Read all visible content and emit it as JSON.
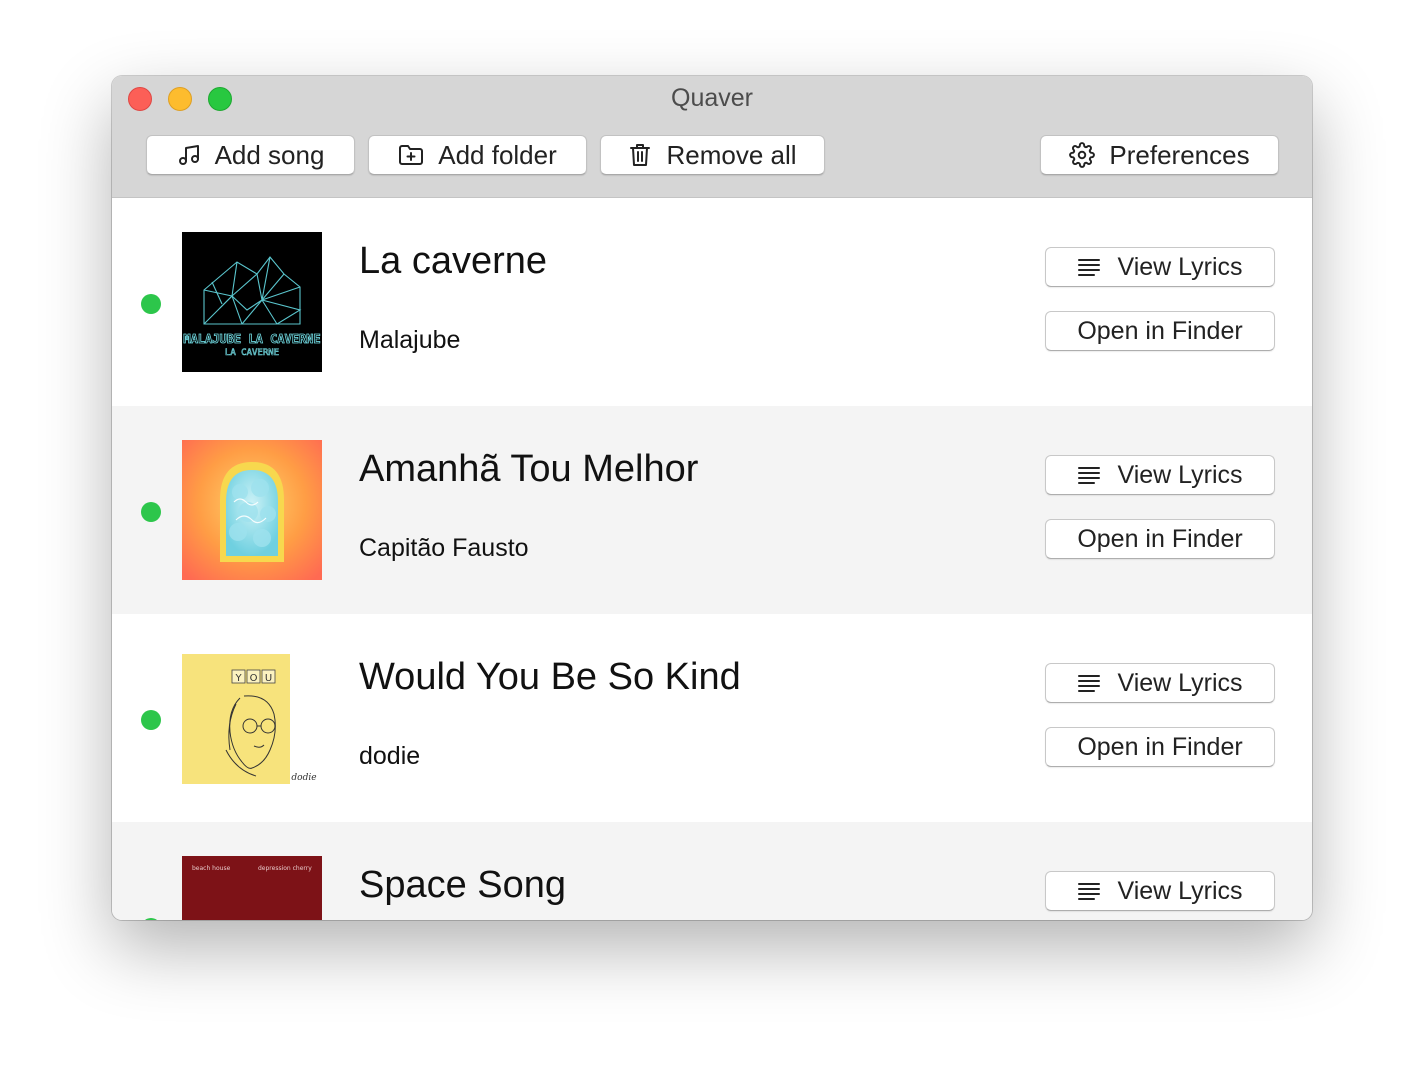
{
  "window": {
    "title": "Quaver"
  },
  "toolbar": {
    "add_song": "Add song",
    "add_folder": "Add folder",
    "remove_all": "Remove all",
    "preferences": "Preferences"
  },
  "songs": [
    {
      "title": "La caverne",
      "artist": "Malajube",
      "status": "ready",
      "artwork_text": "MALAJUBE LA CAVERNE"
    },
    {
      "title": "Amanhã Tou Melhor",
      "artist": "Capitão Fausto",
      "status": "ready"
    },
    {
      "title": "Would You Be So Kind",
      "artist": "dodie",
      "status": "ready",
      "artwork_text": "Y.O.U. dodie"
    },
    {
      "title": "Space Song",
      "artist": "",
      "status": "ready",
      "artwork_text": "beach house depression cherry"
    }
  ],
  "row_buttons": {
    "view_lyrics": "View Lyrics",
    "open_in_finder": "Open in Finder"
  },
  "colors": {
    "status_dot": "#2dc64b",
    "titlebar": "#d6d6d6",
    "alt_row": "#f4f4f4"
  }
}
